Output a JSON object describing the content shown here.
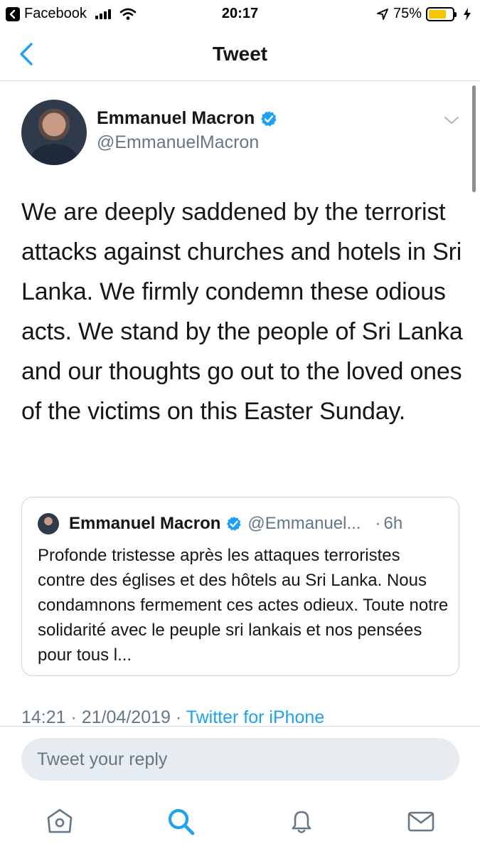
{
  "status_bar": {
    "back_app": "Facebook",
    "time": "20:17",
    "battery_percent_text": "75%",
    "battery_level": 0.75
  },
  "nav": {
    "title": "Tweet"
  },
  "tweet": {
    "author_name": "Emmanuel Macron",
    "author_handle": "@EmmanuelMacron",
    "text": "We are deeply saddened by the terrorist attacks against churches and hotels in Sri Lanka. We firmly condemn these odious acts. We stand by the people of Sri Lanka and our thoughts go out to the loved ones of the victims on this Easter Sunday.",
    "quote": {
      "author_name": "Emmanuel Macron",
      "author_handle": "@Emmanuel...",
      "separator": "·",
      "time": "6h",
      "text": "Profonde tristesse après les attaques terroristes contre des églises et des hôtels au Sri Lanka. Nous condamnons fermement ces actes odieux. Toute notre solidarité avec le peuple sri lankais et nos pensées pour tous l..."
    },
    "meta": {
      "time": "14:21",
      "date": "21/04/2019",
      "separator": "·",
      "source": "Twitter for iPhone"
    }
  },
  "reply": {
    "placeholder": "Tweet your reply"
  },
  "tabbar": {
    "items": [
      "home-icon",
      "search-icon",
      "notifications-icon",
      "messages-icon"
    ],
    "active_color": "#1da1f2",
    "inactive_color": "#657786"
  },
  "colors": {
    "accent": "#1da1f2",
    "secondary_text": "#657786",
    "battery": "#f7c600"
  }
}
